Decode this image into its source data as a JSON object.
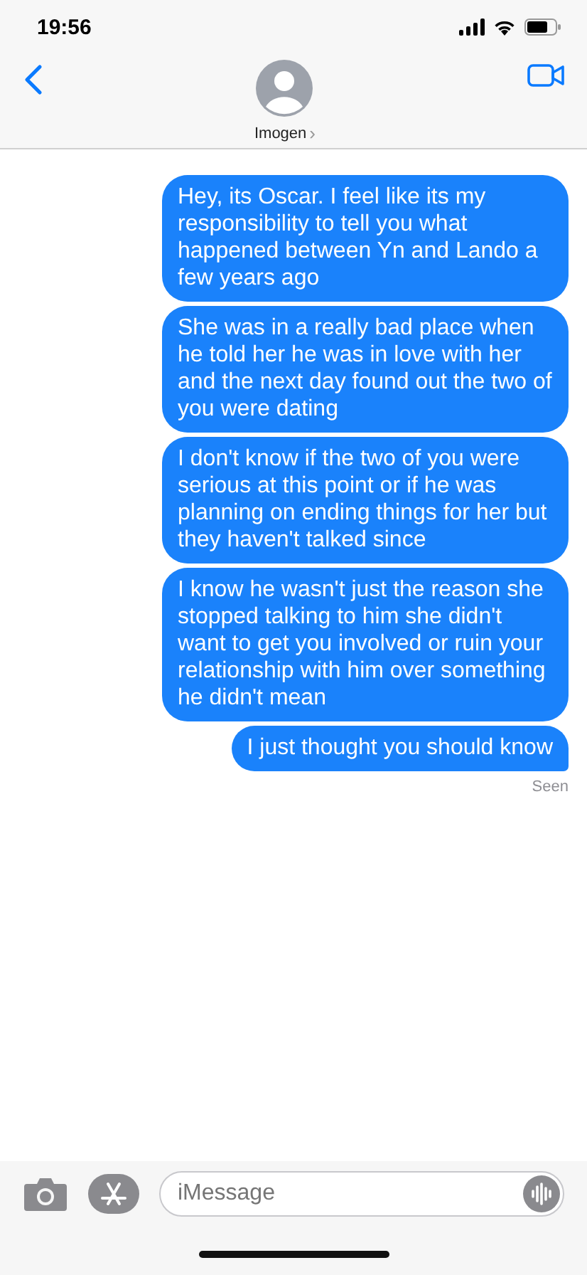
{
  "status_bar": {
    "time": "19:56"
  },
  "header": {
    "contact_name": "Imogen",
    "chevron": "›"
  },
  "messages": [
    {
      "text": "Hey, its Oscar. I feel like its my responsibility to tell you what happened between Yn and Lando a few years ago",
      "tail": false
    },
    {
      "text": "She was in a really bad place when he told her he was in love with her and the next day found out the two of you were dating",
      "tail": false
    },
    {
      "text": "I don't know if the two of you were serious at this point or if he was planning on ending things for her but they haven't talked since",
      "tail": false
    },
    {
      "text": "I know he wasn't just the reason she stopped talking to him she didn't want to get you involved or ruin your relationship with him over something he didn't mean",
      "tail": false
    },
    {
      "text": "I just thought you should know",
      "tail": true
    }
  ],
  "receipt": "Seen",
  "composer": {
    "placeholder": "iMessage"
  }
}
